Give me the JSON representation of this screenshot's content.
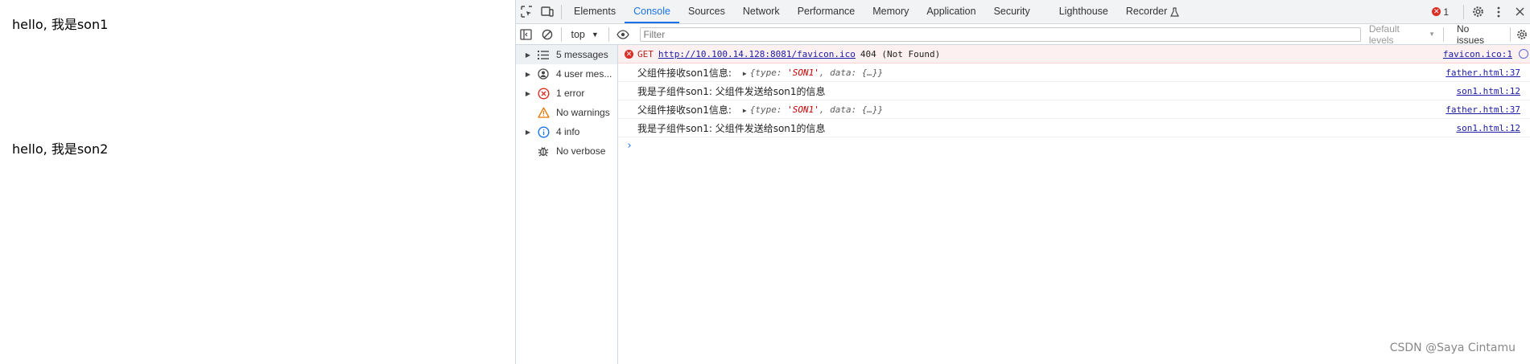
{
  "page": {
    "lines": [
      "hello, 我是son1",
      "hello, 我是son2"
    ]
  },
  "devtools": {
    "tabs": [
      "Elements",
      "Console",
      "Sources",
      "Network",
      "Performance",
      "Memory",
      "Application",
      "Security",
      "Lighthouse",
      "Recorder"
    ],
    "active_tab": "Console",
    "error_count": "1",
    "toolbar": {
      "context": "top",
      "filter_placeholder": "Filter",
      "levels": "Default levels",
      "issues": "No issues"
    },
    "sidebar": [
      {
        "label": "5 messages",
        "icon": "list-icon",
        "expandable": true
      },
      {
        "label": "4 user mes...",
        "icon": "user-icon",
        "expandable": true
      },
      {
        "label": "1 error",
        "icon": "error-icon",
        "expandable": true
      },
      {
        "label": "No warnings",
        "icon": "warning-icon",
        "expandable": false
      },
      {
        "label": "4 info",
        "icon": "info-icon",
        "expandable": true
      },
      {
        "label": "No verbose",
        "icon": "bug-icon",
        "expandable": false
      }
    ],
    "messages": [
      {
        "type": "error",
        "method": "GET",
        "url": "http://10.100.14.128:8081/favicon.ico",
        "status": "404 (Not Found)",
        "source": "favicon.ico:1"
      },
      {
        "type": "log",
        "text": "父组件接收son1信息:",
        "obj_prefix": "{type: ",
        "obj_str": "'SON1'",
        "obj_suffix": ", data: {…}}",
        "source": "father.html:37"
      },
      {
        "type": "log",
        "text": "我是子组件son1: 父组件发送给son1的信息",
        "source": "son1.html:12"
      },
      {
        "type": "log",
        "text": "父组件接收son1信息:",
        "obj_prefix": "{type: ",
        "obj_str": "'SON1'",
        "obj_suffix": ", data: {…}}",
        "source": "father.html:37"
      },
      {
        "type": "log",
        "text": "我是子组件son1: 父组件发送给son1的信息",
        "source": "son1.html:12"
      }
    ],
    "prompt": "›"
  },
  "watermark": "CSDN @Saya Cintamu",
  "colors": {
    "accent": "#1a73e8",
    "error": "#d93025",
    "error_bg": "#fdf0f0"
  }
}
